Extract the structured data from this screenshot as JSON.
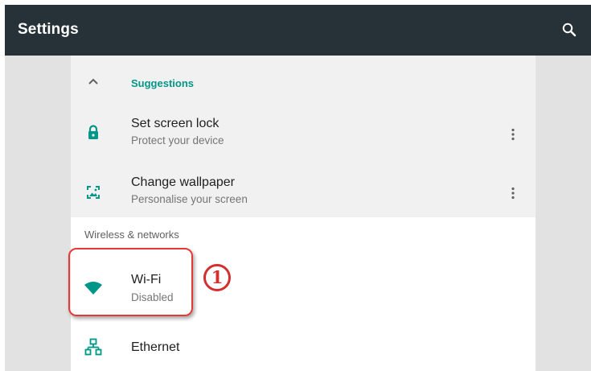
{
  "appbar": {
    "title": "Settings",
    "search_icon": "search-icon"
  },
  "suggestions": {
    "header_label": "Suggestions",
    "collapse_icon": "chevron-up-icon",
    "items": [
      {
        "title": "Set screen lock",
        "summary": "Protect your device",
        "icon": "lock-icon",
        "menu_icon": "more-vert-icon"
      },
      {
        "title": "Change wallpaper",
        "summary": "Personalise your screen",
        "icon": "wallpaper-icon",
        "menu_icon": "more-vert-icon"
      }
    ]
  },
  "sections": [
    {
      "title": "Wireless & networks",
      "items": [
        {
          "title": "Wi-Fi",
          "summary": "Disabled",
          "icon": "wifi-icon"
        },
        {
          "title": "Ethernet",
          "summary": "",
          "icon": "ethernet-icon"
        }
      ]
    }
  ],
  "annotation": {
    "marker_label": "1",
    "color": "#d32f2f"
  },
  "colors": {
    "appbar": "#263238",
    "accent": "#009688",
    "background": "#e2e2e2",
    "suggestion_bg": "#f1f1f1"
  }
}
